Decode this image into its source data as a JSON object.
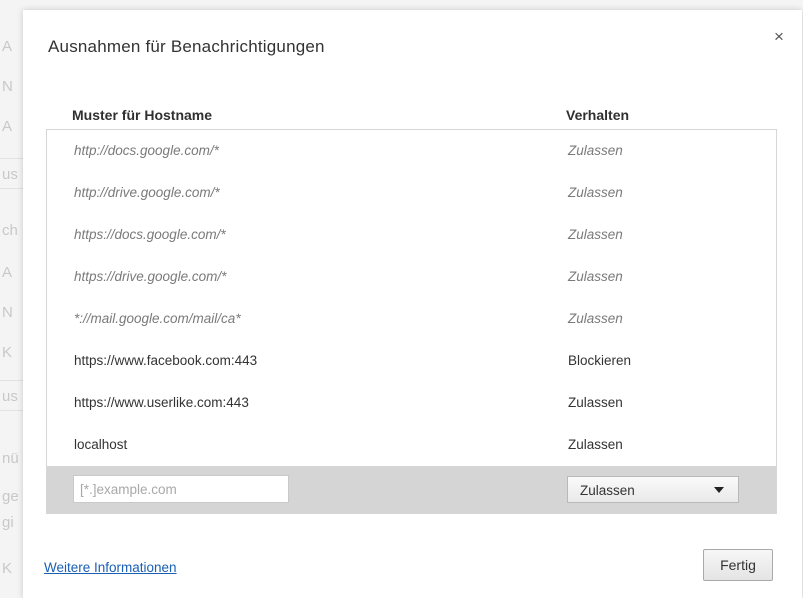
{
  "dialog": {
    "title": "Ausnahmen für Benachrichtigungen",
    "close_label": "×",
    "columns": {
      "pattern": "Muster für Hostname",
      "behavior": "Verhalten"
    },
    "exceptions": [
      {
        "pattern": "http://docs.google.com/*",
        "behavior": "Zulassen",
        "managed": true
      },
      {
        "pattern": "http://drive.google.com/*",
        "behavior": "Zulassen",
        "managed": true
      },
      {
        "pattern": "https://docs.google.com/*",
        "behavior": "Zulassen",
        "managed": true
      },
      {
        "pattern": "https://drive.google.com/*",
        "behavior": "Zulassen",
        "managed": true
      },
      {
        "pattern": "*://mail.google.com/mail/ca*",
        "behavior": "Zulassen",
        "managed": true
      },
      {
        "pattern": "https://www.facebook.com:443",
        "behavior": "Blockieren",
        "managed": false
      },
      {
        "pattern": "https://www.userlike.com:443",
        "behavior": "Zulassen",
        "managed": false
      },
      {
        "pattern": "localhost",
        "behavior": "Zulassen",
        "managed": false
      }
    ],
    "new_entry": {
      "placeholder": "[*.]example.com",
      "value": "",
      "behavior_selected": "Zulassen"
    },
    "more_info_link": "Weitere Informationen",
    "done_button": "Fertig"
  },
  "background": {
    "fragments": [
      "A",
      "N",
      "A",
      "us",
      "ch",
      "A",
      "N",
      "K",
      "us",
      "nü",
      "ge",
      "gi",
      "K"
    ]
  }
}
